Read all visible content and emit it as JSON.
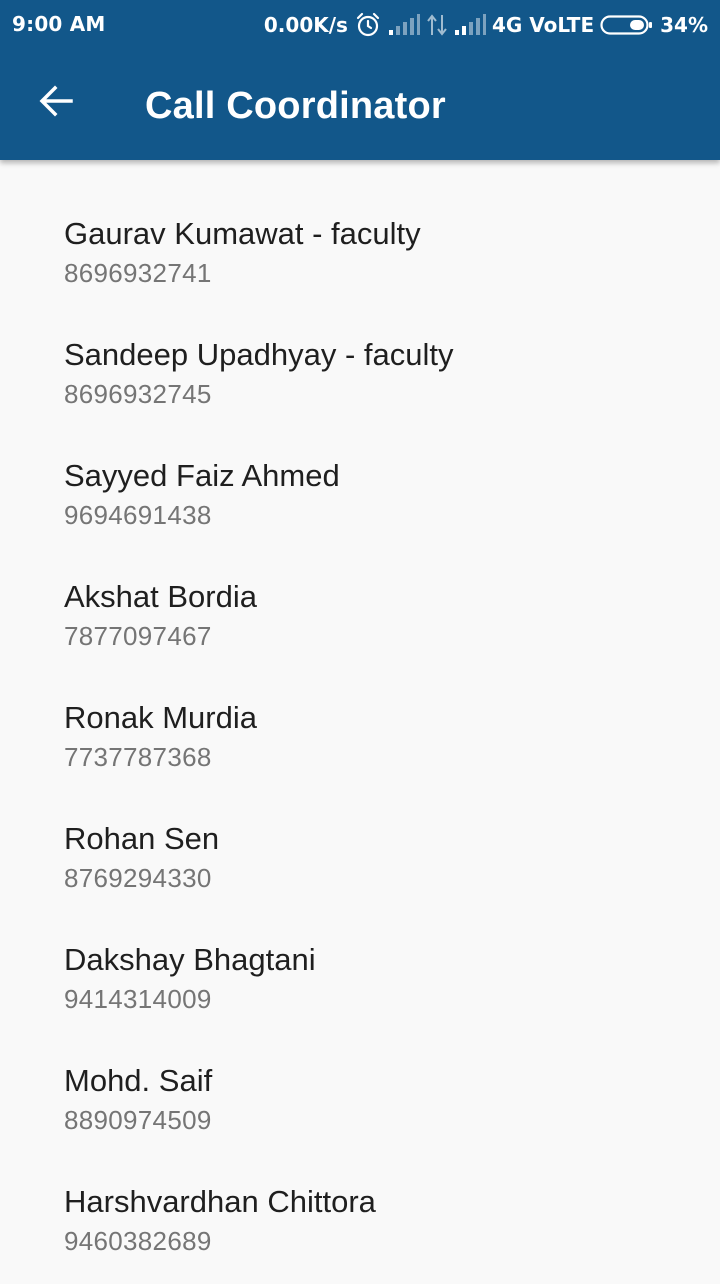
{
  "status_bar": {
    "time": "9:00 AM",
    "net_speed": "0.00K/s",
    "network": "4G VoLTE",
    "battery": "34%",
    "icons": [
      "alarm-icon",
      "signal-icon",
      "data-arrows-icon",
      "signal-icon",
      "battery-icon"
    ]
  },
  "toolbar": {
    "back_icon": "arrow-back-icon",
    "title": "Call Coordinator",
    "background": "#12578a"
  },
  "contacts": [
    {
      "name": "Gaurav Kumawat - faculty",
      "phone": "8696932741"
    },
    {
      "name": "Sandeep Upadhyay - faculty",
      "phone": "8696932745"
    },
    {
      "name": "Sayyed Faiz Ahmed",
      "phone": "9694691438"
    },
    {
      "name": "Akshat Bordia",
      "phone": "7877097467"
    },
    {
      "name": "Ronak Murdia",
      "phone": "7737787368"
    },
    {
      "name": "Rohan Sen",
      "phone": "8769294330"
    },
    {
      "name": "Dakshay Bhagtani",
      "phone": "9414314009"
    },
    {
      "name": "Mohd. Saif",
      "phone": "8890974509"
    },
    {
      "name": "Harshvardhan Chittora",
      "phone": "9460382689"
    }
  ]
}
